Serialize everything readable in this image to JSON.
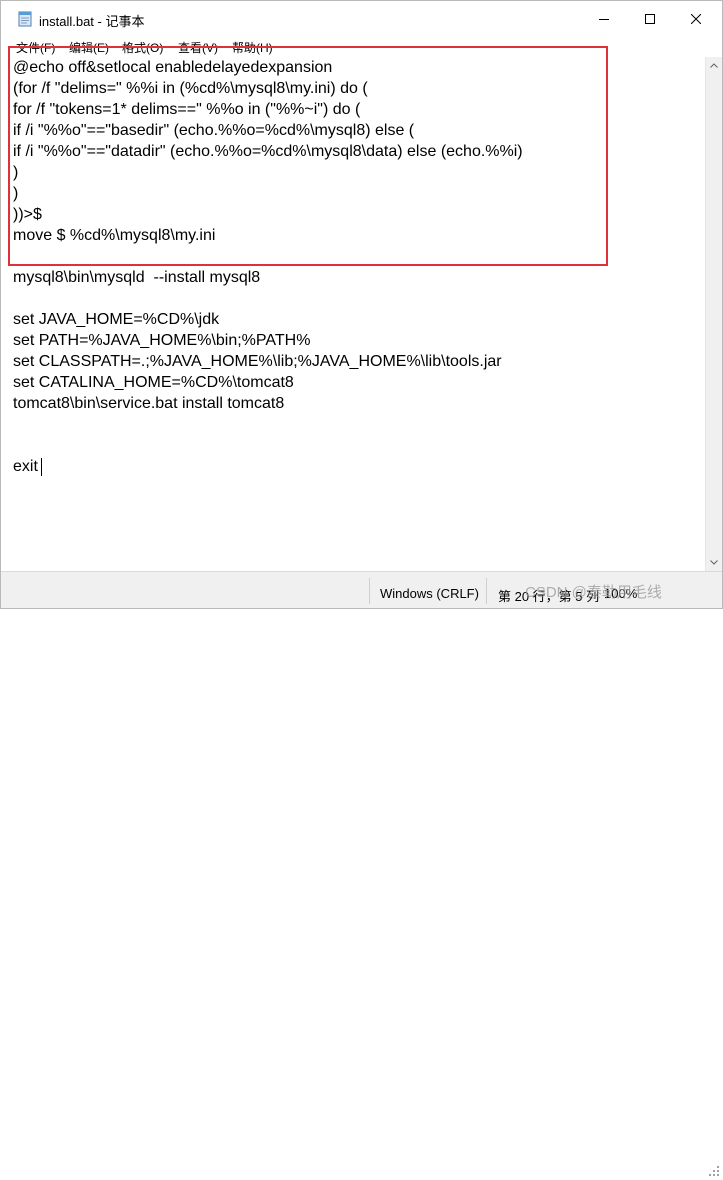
{
  "window": {
    "title": "install.bat - 记事本"
  },
  "menu": [
    {
      "label": "文件(F)"
    },
    {
      "label": "编辑(E)"
    },
    {
      "label": "格式(O)"
    },
    {
      "label": "查看(V)"
    },
    {
      "label": "帮助(H)"
    }
  ],
  "editor": {
    "lines": [
      "@echo off&setlocal enabledelayedexpansion",
      "(for /f \"delims=\" %%i in (%cd%\\mysql8\\my.ini) do (",
      "for /f \"tokens=1* delims==\" %%o in (\"%%~i\") do (",
      "if /i \"%%o\"==\"basedir\" (echo.%%o=%cd%\\mysql8) else (",
      "if /i \"%%o\"==\"datadir\" (echo.%%o=%cd%\\mysql8\\data) else (echo.%%i)",
      ")",
      ")",
      "))>$",
      "move $ %cd%\\mysql8\\my.ini",
      "",
      "mysql8\\bin\\mysqld  --install mysql8",
      "",
      "set JAVA_HOME=%CD%\\jdk",
      "set PATH=%JAVA_HOME%\\bin;%PATH%",
      "set CLASSPATH=.;%JAVA_HOME%\\lib;%JAVA_HOME%\\lib\\tools.jar",
      "set CATALINA_HOME=%CD%\\tomcat8",
      "tomcat8\\bin\\service.bat install tomcat8",
      "",
      "",
      "exit"
    ]
  },
  "status": {
    "encoding": "Windows (CRLF)",
    "position": "第 20 行，第 5 列",
    "zoom": "100%"
  },
  "watermark": "CSDN @泰勒用毛线",
  "colors": {
    "highlight": "#e0303a"
  }
}
